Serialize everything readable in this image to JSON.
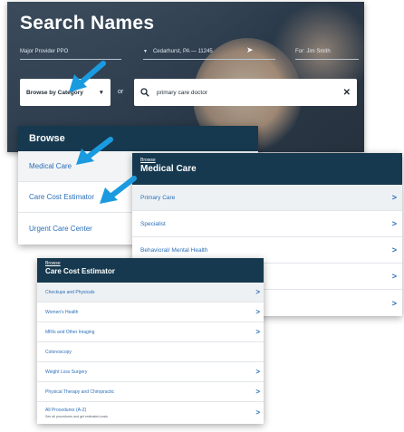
{
  "hero": {
    "title": "Search Names",
    "provider": "Major Provider PPO",
    "location": "Cedarhurst, PA — 11245",
    "for_person": "For: Jim Smith",
    "browse_select": "Browse by Category",
    "or_text": "or",
    "search_value": "primary care doctor",
    "clear_symbol": "✕"
  },
  "browse_panel": {
    "title": "Browse",
    "items": [
      {
        "label": "Medical Care"
      },
      {
        "label": "Care Cost Estimator"
      },
      {
        "label": "Urgent Care Center"
      }
    ]
  },
  "medical_panel": {
    "crumb": "Browse",
    "title": "Medical Care",
    "items": [
      {
        "label": "Primary Care"
      },
      {
        "label": "Specialist"
      },
      {
        "label": "Behavioral/ Mental Health"
      },
      {
        "label": ""
      },
      {
        "label": ""
      }
    ]
  },
  "estimator_panel": {
    "crumb": "Browse",
    "title": "Care Cost Estimator",
    "items": [
      {
        "label": "Checkups and Physicals",
        "sub": ""
      },
      {
        "label": "Women's Health",
        "sub": ""
      },
      {
        "label": "MRIs and Other Imaging",
        "sub": ""
      },
      {
        "label": "Colonoscopy",
        "sub": ""
      },
      {
        "label": "Weight Loss Surgery",
        "sub": ""
      },
      {
        "label": "Physical Therapy and Chiropractic",
        "sub": ""
      },
      {
        "label": "All Procedures (A-Z)",
        "sub": "See all procedures and get estimated costs"
      }
    ]
  },
  "chevron": ">",
  "colors": {
    "panel_header": "#16394f",
    "link_blue": "#2a6fb8",
    "arrow_blue": "#1a9be0"
  },
  "icons": {
    "search": "search-icon",
    "location": "location-arrow-icon",
    "dropdown": "chevron-down-icon"
  }
}
